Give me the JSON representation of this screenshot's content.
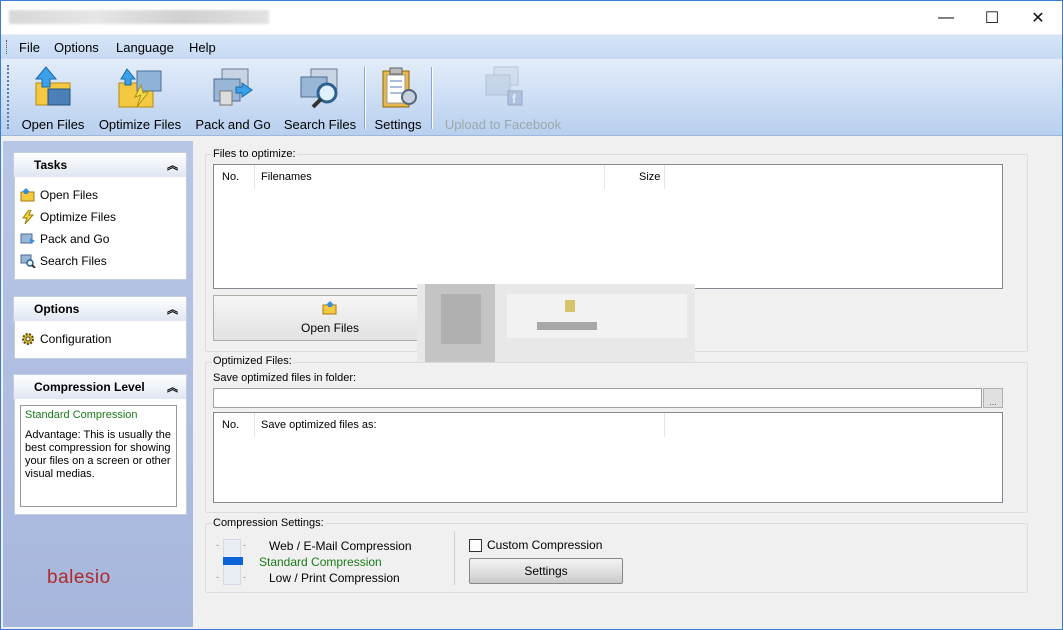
{
  "window": {
    "minimize": "—",
    "maximize": "☐",
    "close": "✕"
  },
  "menu": [
    "File",
    "Options",
    "Language",
    "Help"
  ],
  "toolbar": [
    {
      "label": "Open Files",
      "icon": "open-files-icon",
      "enabled": true
    },
    {
      "label": "Optimize Files",
      "icon": "optimize-files-icon",
      "enabled": true
    },
    {
      "label": "Pack and Go",
      "icon": "pack-and-go-icon",
      "enabled": true
    },
    {
      "label": "Search Files",
      "icon": "search-files-icon",
      "enabled": true
    },
    {
      "label": "Settings",
      "icon": "settings-icon",
      "enabled": true
    },
    {
      "label": "Upload to Facebook",
      "icon": "upload-facebook-icon",
      "enabled": false
    }
  ],
  "sidebar": {
    "tasks": {
      "title": "Tasks",
      "items": [
        "Open Files",
        "Optimize Files",
        "Pack and Go",
        "Search Files"
      ]
    },
    "options": {
      "title": "Options",
      "items": [
        "Configuration"
      ]
    },
    "compression": {
      "title": "Compression Level",
      "level": "Standard Compression",
      "description": "Advantage: This is usually the best compression for showing your files on a screen or other visual medias."
    },
    "logo": "balesio"
  },
  "files_to_optimize": {
    "label": "Files to optimize:",
    "columns": [
      "No.",
      "Filenames",
      "Size"
    ],
    "open_button": "Open Files"
  },
  "optimized_files": {
    "label": "Optimized Files:",
    "folder_label": "Save optimized files in folder:",
    "folder_value": "",
    "browse": "...",
    "columns": [
      "No.",
      "Save optimized files as:"
    ]
  },
  "compression_settings": {
    "label": "Compression Settings:",
    "levels": [
      "Web / E-Mail Compression",
      "Standard Compression",
      "Low / Print Compression"
    ],
    "selected": "Standard Compression",
    "custom_label": "Custom Compression",
    "custom_checked": false,
    "settings_button": "Settings"
  },
  "colors": {
    "accent": "#0a64d8",
    "selected_text": "#1a7a1a",
    "logo": "#b02a2a"
  }
}
